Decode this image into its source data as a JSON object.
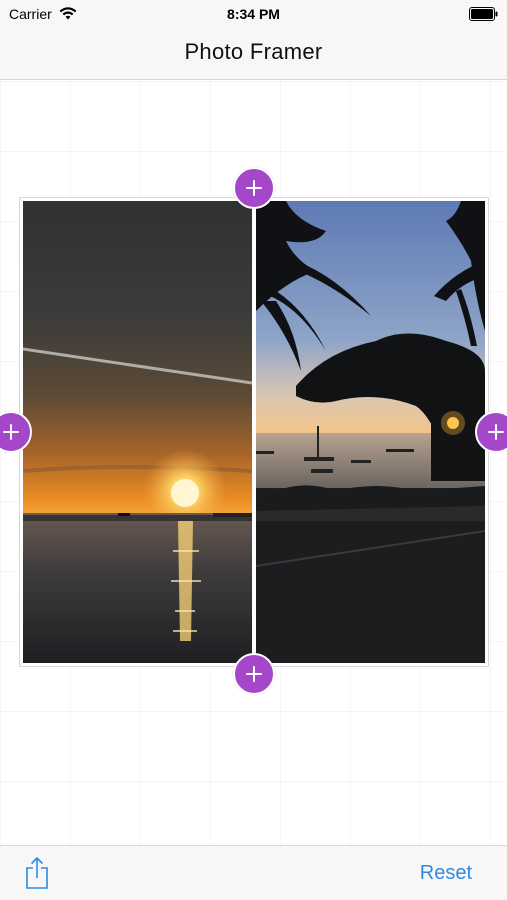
{
  "status_bar": {
    "carrier": "Carrier",
    "time": "8:34 PM",
    "wifi_icon": "wifi-icon",
    "battery_icon": "battery-icon"
  },
  "nav": {
    "title": "Photo Framer"
  },
  "frame": {
    "photos": [
      {
        "name": "sunset-over-sea-photo"
      },
      {
        "name": "palm-tree-beach-silhouette-photo"
      }
    ],
    "add_buttons": [
      {
        "name": "add-top-button",
        "icon": "plus-icon"
      },
      {
        "name": "add-bottom-button",
        "icon": "plus-icon"
      },
      {
        "name": "add-left-button",
        "icon": "plus-icon"
      },
      {
        "name": "add-right-button",
        "icon": "plus-icon"
      }
    ]
  },
  "toolbar": {
    "share_icon": "share-icon",
    "reset_label": "Reset"
  },
  "colors": {
    "accent_purple": "#a447c8",
    "link_blue": "#2d8be6",
    "bar_background": "#f7f7f7"
  }
}
